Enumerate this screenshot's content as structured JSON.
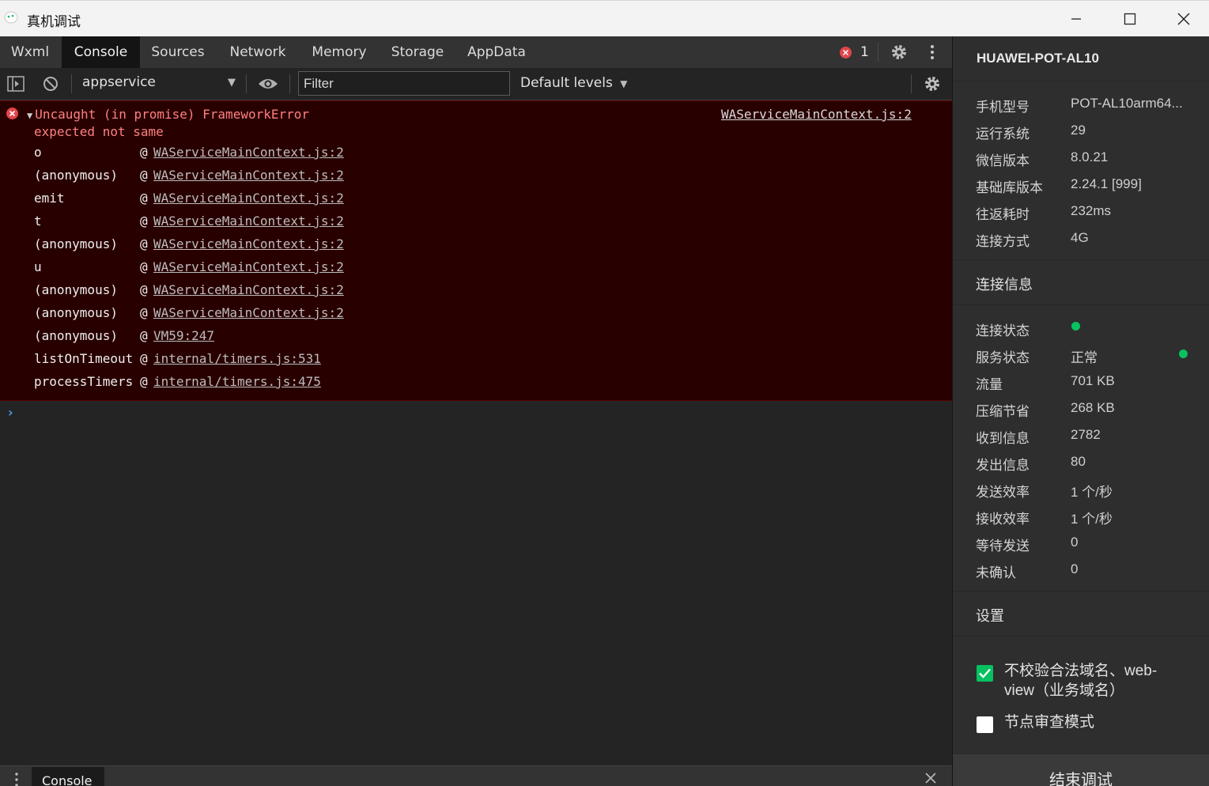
{
  "window": {
    "title": "真机调试"
  },
  "tabs": [
    "Wxml",
    "Console",
    "Sources",
    "Network",
    "Memory",
    "Storage",
    "AppData"
  ],
  "active_tab": "Console",
  "error_badge_count": "1",
  "toolbar": {
    "context": "appservice",
    "filter_placeholder": "Filter",
    "levels": "Default levels"
  },
  "console": {
    "error_line1": "Uncaught (in promise) FrameworkError",
    "error_line2": "expected not same",
    "error_source": "WAServiceMainContext.js:2",
    "stack": [
      {
        "fn": "o",
        "src": "WAServiceMainContext.js:2"
      },
      {
        "fn": "(anonymous)",
        "src": "WAServiceMainContext.js:2"
      },
      {
        "fn": "emit",
        "src": "WAServiceMainContext.js:2"
      },
      {
        "fn": "t",
        "src": "WAServiceMainContext.js:2"
      },
      {
        "fn": "(anonymous)",
        "src": "WAServiceMainContext.js:2"
      },
      {
        "fn": "u",
        "src": "WAServiceMainContext.js:2"
      },
      {
        "fn": "(anonymous)",
        "src": "WAServiceMainContext.js:2"
      },
      {
        "fn": "(anonymous)",
        "src": "WAServiceMainContext.js:2"
      },
      {
        "fn": "(anonymous)",
        "src": "VM59:247"
      },
      {
        "fn": "listOnTimeout",
        "src": "internal/timers.js:531"
      },
      {
        "fn": "processTimers",
        "src": "internal/timers.js:475"
      }
    ],
    "at_symbol": "@",
    "prompt": "›"
  },
  "drawer": {
    "tab": "Console"
  },
  "device": {
    "name": "HUAWEI-POT-AL10",
    "info": [
      {
        "k": "手机型号",
        "v": "POT-AL10arm64..."
      },
      {
        "k": "运行系统",
        "v": "29"
      },
      {
        "k": "微信版本",
        "v": "8.0.21"
      },
      {
        "k": "基础库版本",
        "v": "2.24.1 [999]"
      },
      {
        "k": "往返耗时",
        "v": "232ms"
      },
      {
        "k": "连接方式",
        "v": "4G"
      }
    ],
    "conn_title": "连接信息",
    "conn": [
      {
        "k": "连接状态",
        "v": ""
      },
      {
        "k": "服务状态",
        "v": "正常"
      },
      {
        "k": "流量",
        "v": "701 KB"
      },
      {
        "k": "压缩节省",
        "v": "268 KB"
      },
      {
        "k": "收到信息",
        "v": "2782"
      },
      {
        "k": "发出信息",
        "v": "80"
      },
      {
        "k": "发送效率",
        "v": "1 个/秒"
      },
      {
        "k": "接收效率",
        "v": "1 个/秒"
      },
      {
        "k": "等待发送",
        "v": "0"
      },
      {
        "k": "未确认",
        "v": "0"
      }
    ],
    "settings_title": "设置",
    "settings": [
      {
        "label": "不校验合法域名、web-view（业务域名）",
        "checked": true
      },
      {
        "label": "节点审查模式",
        "checked": false
      }
    ],
    "end_button": "结束调试"
  },
  "colors": {
    "accent_green": "#07c160",
    "error_red": "#e0454a",
    "error_bg": "#290000"
  }
}
